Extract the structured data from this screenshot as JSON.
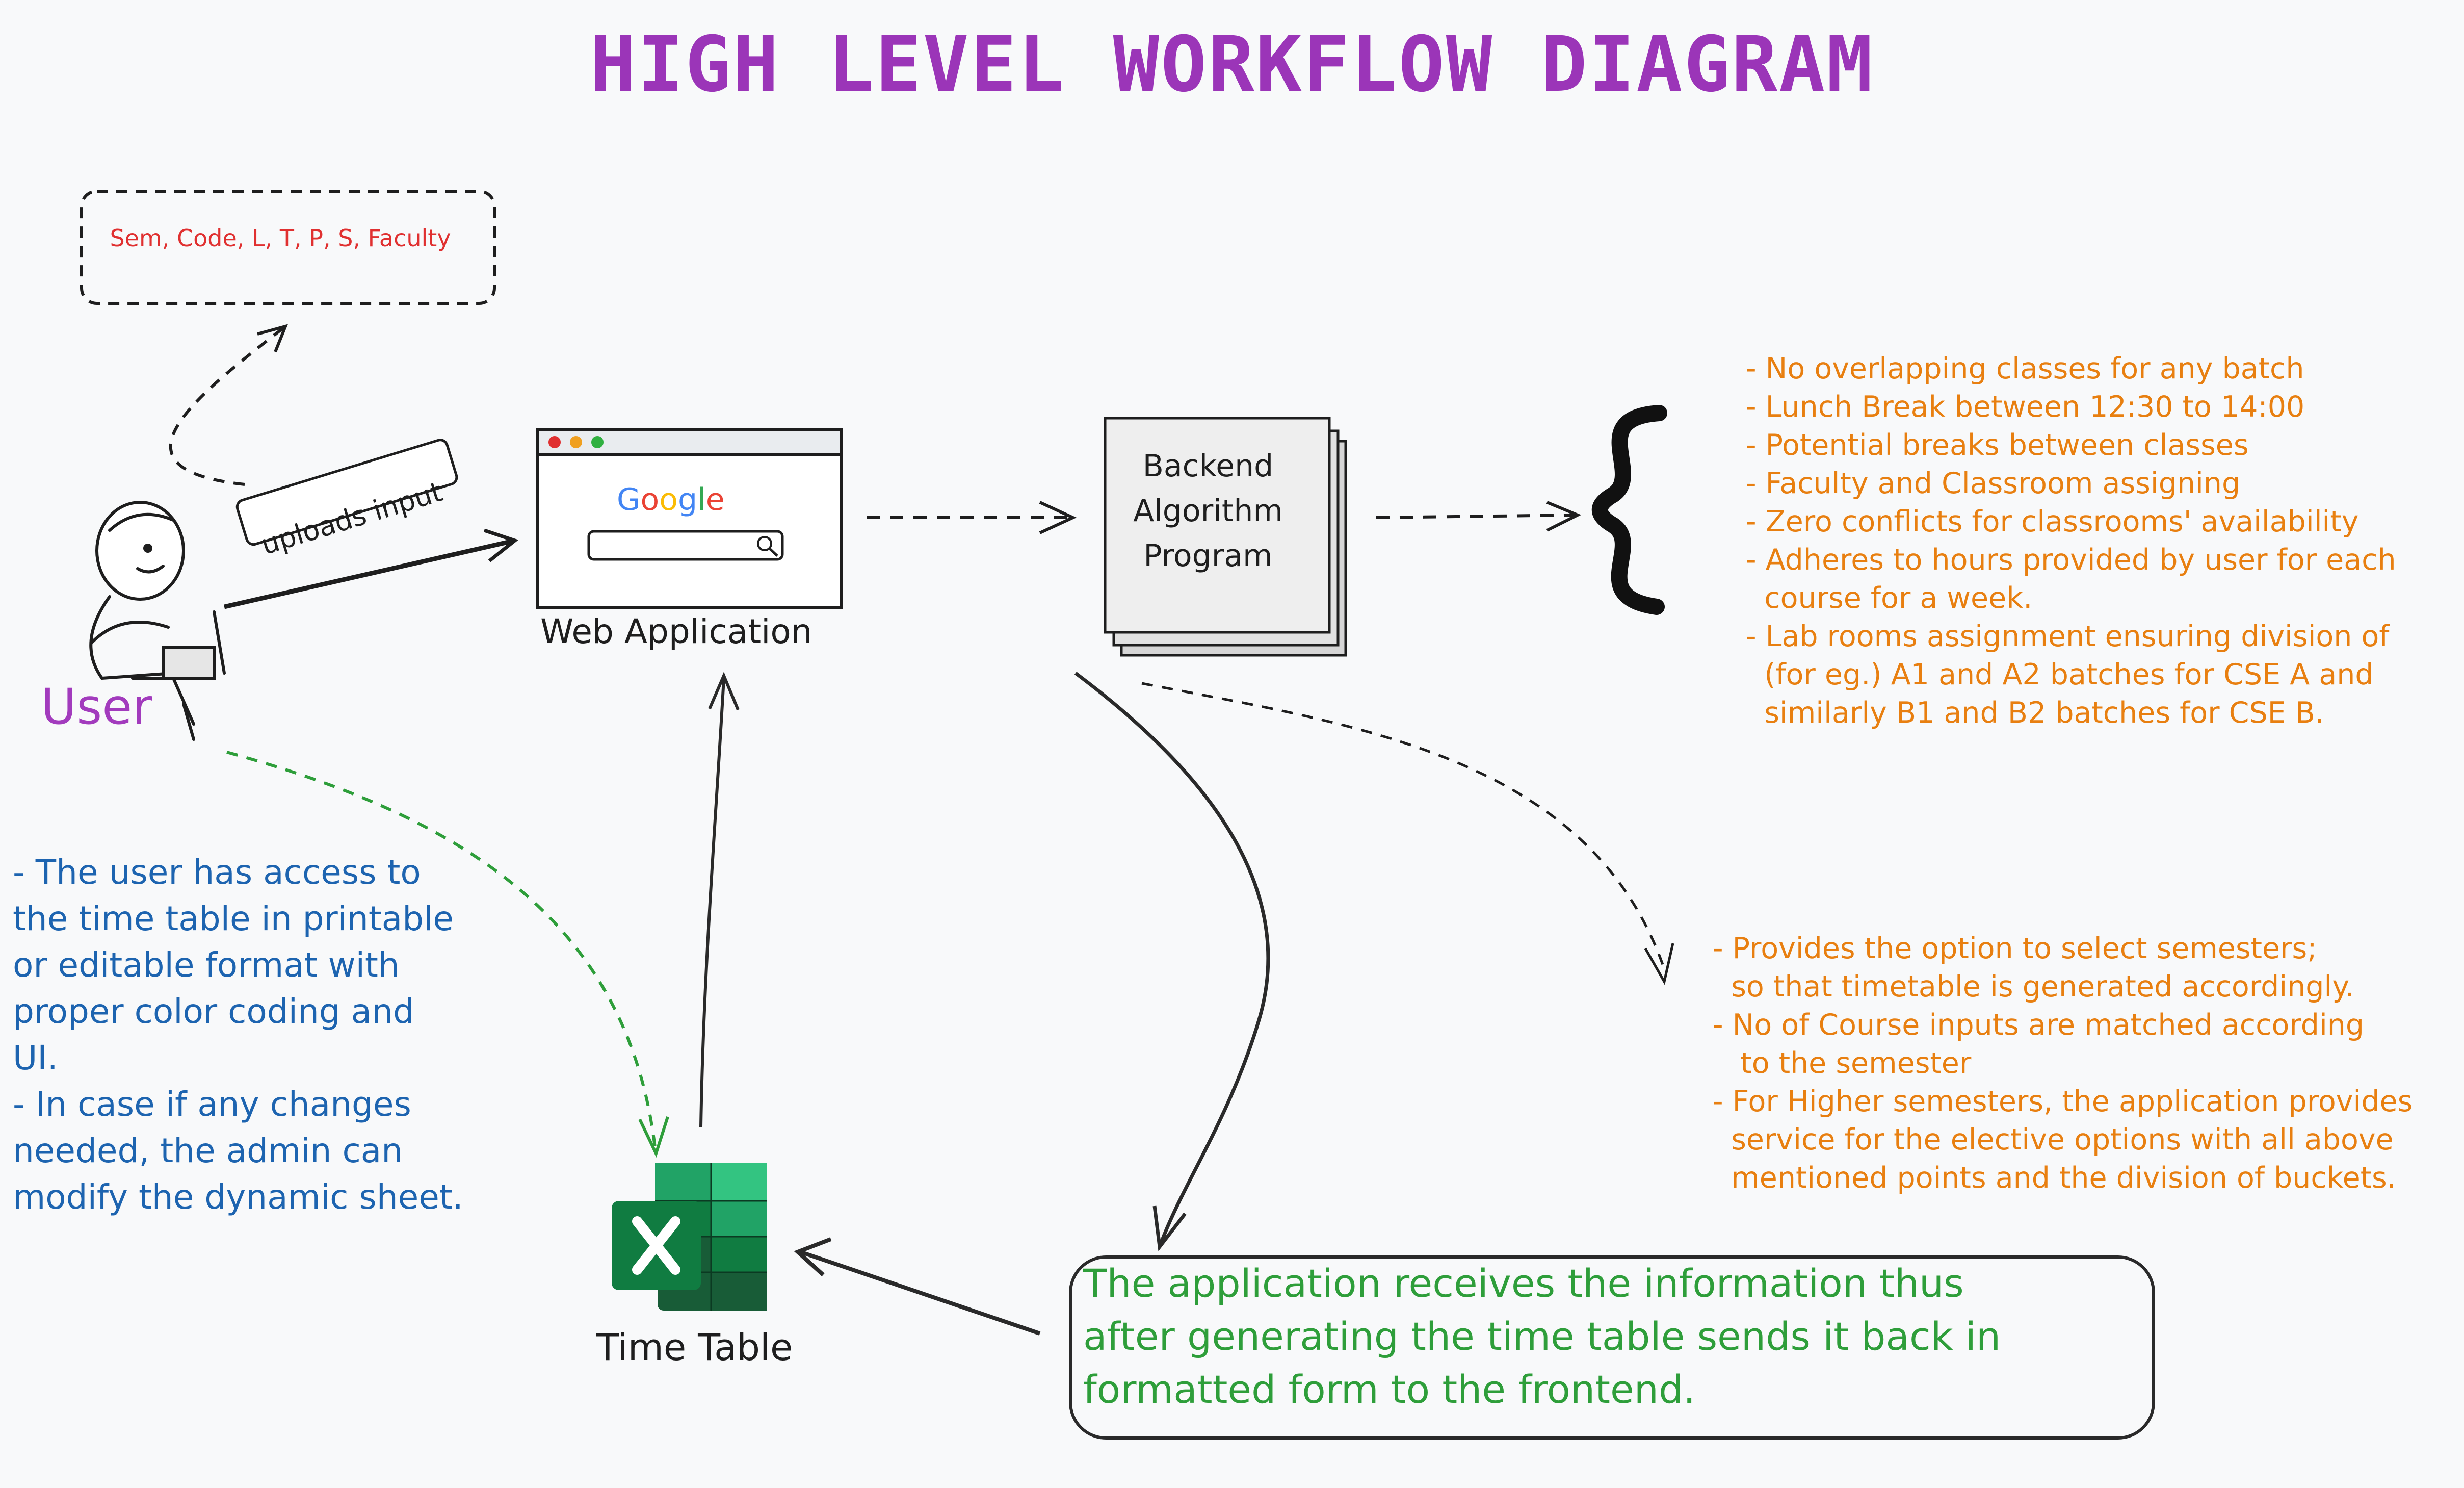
{
  "title": "HIGH LEVEL WORKFLOW DIAGRAM",
  "input_fields": "Sem, Code, L, T, P, S, Faculty",
  "user_label": "User",
  "uploads_label": "uploads input",
  "web_app": {
    "label": "Web Application",
    "search_logo": "Google"
  },
  "backend": {
    "lines": [
      "Backend",
      "Algorithm",
      "Program"
    ]
  },
  "constraints": [
    "- No overlapping classes for any batch",
    "- Lunch Break between 12:30 to 14:00",
    "- Potential breaks between classes",
    "- Faculty and Classroom assigning",
    "- Zero conflicts for classrooms' availability",
    "- Adheres to hours provided by user for each",
    "  course for a week.",
    "- Lab rooms assignment ensuring division of",
    "  (for eg.) A1 and A2 batches for CSE A and",
    "  similarly B1 and B2 batches for CSE B."
  ],
  "semester_features": [
    "- Provides the option to select semesters;",
    "  so that timetable is generated accordingly.",
    "- No of Course inputs are matched according",
    "   to the semester",
    "- For Higher semesters, the application provides",
    "  service for the elective options with all above",
    "  mentioned points and the division of buckets."
  ],
  "user_notes": [
    "- The user has access to",
    "the time table in printable",
    "or editable format with",
    "proper color coding and",
    "UI.",
    "- In case if any changes",
    "needed, the admin can",
    "modify the dynamic sheet."
  ],
  "return_note": [
    "The application receives the information thus",
    "after generating the time table sends it back in",
    "formatted form to the frontend."
  ],
  "time_table_label": "Time Table",
  "colors": {
    "title": "#9b35b8",
    "orange_text": "#e87f10",
    "blue_text": "#1d64b0",
    "green_text": "#2e9e3a",
    "red_text": "#e03030",
    "excel_green": "#107c41"
  }
}
